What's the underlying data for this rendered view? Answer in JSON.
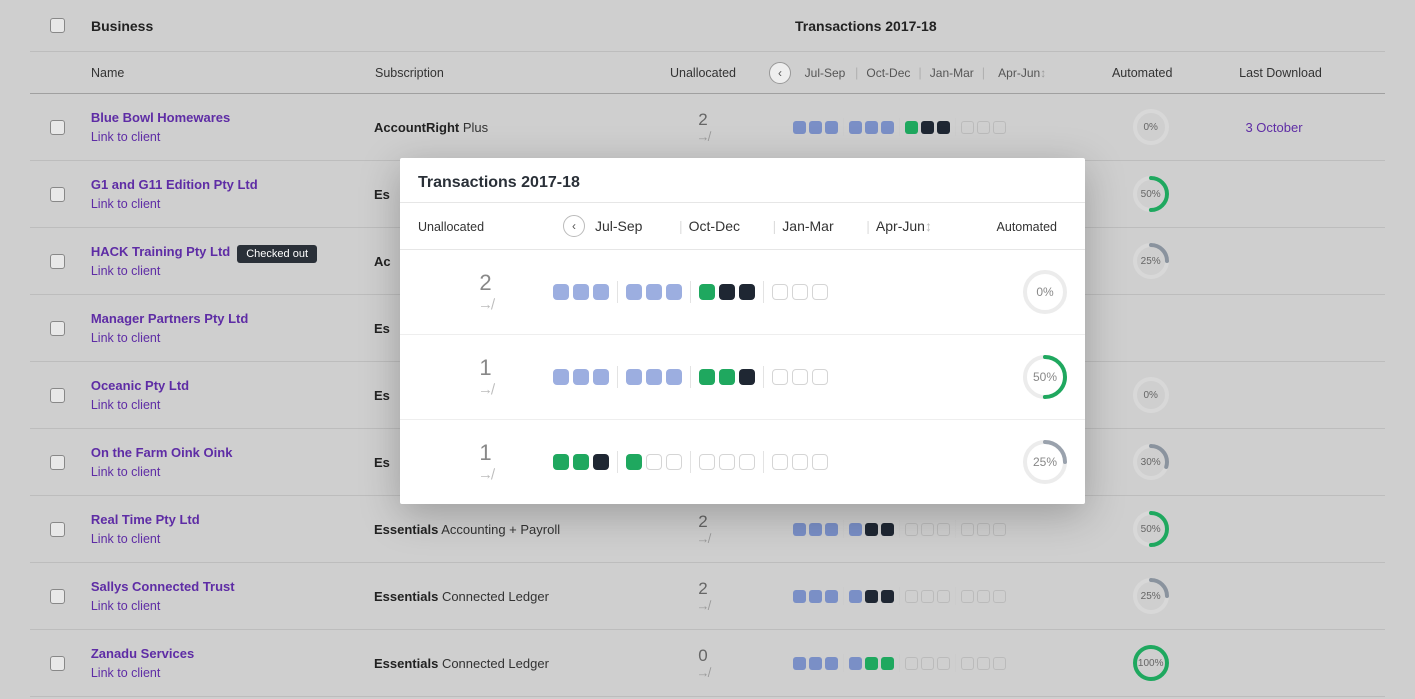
{
  "headers": {
    "business": "Business",
    "transactions": "Transactions 2017-18",
    "name": "Name",
    "subscription": "Subscription",
    "unallocated": "Unallocated",
    "quarters": [
      "Jul-Sep",
      "Oct-Dec",
      "Jan-Mar",
      "Apr-Jun"
    ],
    "automated": "Automated",
    "last_download": "Last Download"
  },
  "link_to_client": "Link to client",
  "unalloc_glyph": "↛",
  "rows": [
    {
      "name": "Blue Bowl Homewares",
      "sub_bold": "AccountRight",
      "sub_rest": " Plus",
      "unalloc": "2",
      "q": [
        [
          "b",
          "b",
          "b"
        ],
        [
          "b",
          "b",
          "b"
        ],
        [
          "g",
          "d",
          "d"
        ],
        [
          "e",
          "e",
          "e"
        ]
      ],
      "auto": 0,
      "download": "3 October"
    },
    {
      "name": "G1 and G11 Edition Pty Ltd",
      "sub_bold": "Es",
      "sub_rest": "",
      "unalloc": "",
      "q": null,
      "auto": 50,
      "download": ""
    },
    {
      "name": "HACK Training Pty Ltd",
      "badge": "Checked out",
      "sub_bold": "Ac",
      "sub_rest": "",
      "unalloc": "",
      "q": null,
      "auto": 25,
      "download": ""
    },
    {
      "name": "Manager Partners Pty Ltd",
      "sub_bold": "Es",
      "sub_rest": "",
      "unalloc": "",
      "q": null,
      "auto": null,
      "download": ""
    },
    {
      "name": "Oceanic Pty Ltd",
      "sub_bold": "Es",
      "sub_rest": "",
      "unalloc": "",
      "q": null,
      "auto": 0,
      "download": ""
    },
    {
      "name": "On the Farm Oink Oink",
      "sub_bold": "Es",
      "sub_rest": "",
      "unalloc": "",
      "q": null,
      "auto": 30,
      "download": ""
    },
    {
      "name": "Real Time Pty Ltd",
      "sub_bold": "Essentials",
      "sub_rest": " Accounting + Payroll",
      "unalloc": "2",
      "q": [
        [
          "b",
          "b",
          "b"
        ],
        [
          "b",
          "d",
          "d"
        ],
        [
          "e",
          "e",
          "e"
        ],
        [
          "e",
          "e",
          "e"
        ]
      ],
      "auto": 50,
      "download": ""
    },
    {
      "name": "Sallys Connected Trust",
      "sub_bold": "Essentials",
      "sub_rest": " Connected Ledger",
      "unalloc": "2",
      "q": [
        [
          "b",
          "b",
          "b"
        ],
        [
          "b",
          "d",
          "d"
        ],
        [
          "e",
          "e",
          "e"
        ],
        [
          "e",
          "e",
          "e"
        ]
      ],
      "auto": 25,
      "download": ""
    },
    {
      "name": "Zanadu Services",
      "sub_bold": "Essentials",
      "sub_rest": " Connected Ledger",
      "unalloc": "0",
      "q": [
        [
          "b",
          "b",
          "b"
        ],
        [
          "b",
          "g",
          "g"
        ],
        [
          "e",
          "e",
          "e"
        ],
        [
          "e",
          "e",
          "e"
        ]
      ],
      "auto": 100,
      "download": ""
    }
  ],
  "popup": {
    "title": "Transactions 2017-18",
    "unallocated": "Unallocated",
    "quarters": [
      "Jul-Sep",
      "Oct-Dec",
      "Jan-Mar",
      "Apr-Jun"
    ],
    "automated": "Automated",
    "rows": [
      {
        "unalloc": "2",
        "q": [
          [
            "b",
            "b",
            "b"
          ],
          [
            "b",
            "b",
            "b"
          ],
          [
            "g",
            "d",
            "d"
          ],
          [
            "e",
            "e",
            "e"
          ]
        ],
        "auto": 0
      },
      {
        "unalloc": "1",
        "q": [
          [
            "b",
            "b",
            "b"
          ],
          [
            "b",
            "b",
            "b"
          ],
          [
            "g",
            "g",
            "d"
          ],
          [
            "e",
            "e",
            "e"
          ]
        ],
        "auto": 50
      },
      {
        "unalloc": "1",
        "q": [
          [
            "g",
            "g",
            "d"
          ],
          [
            "g",
            "e",
            "e"
          ],
          [
            "e",
            "e",
            "e"
          ],
          [
            "e",
            "e",
            "e"
          ]
        ],
        "auto": 25
      }
    ]
  }
}
